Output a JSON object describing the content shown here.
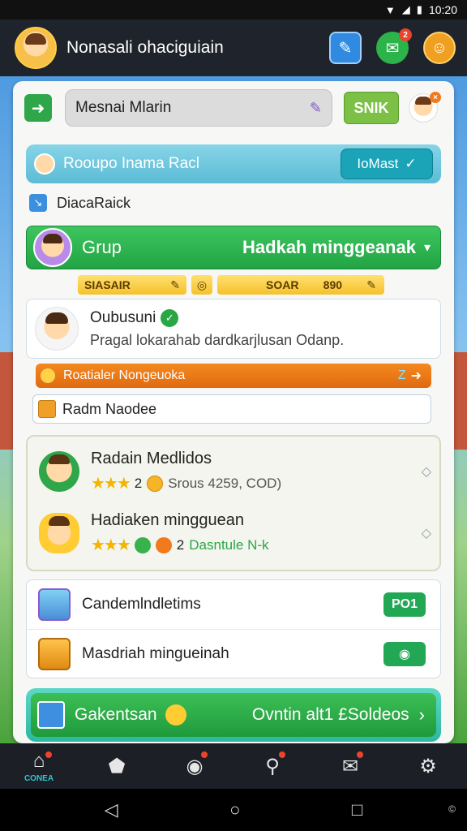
{
  "status_bar": {
    "time": "10:20",
    "wifi_icon": "wifi-icon",
    "signal_icon": "signal-icon",
    "battery_icon": "battery-icon"
  },
  "app_bar": {
    "title": "Nonasali ohaciguiain",
    "buttons": [
      {
        "icon": "edit-icon"
      },
      {
        "icon": "chat-icon",
        "badge": "2"
      },
      {
        "icon": "profile-icon"
      }
    ]
  },
  "search": {
    "value": "Mesnai Mlarin",
    "button": "SNIK"
  },
  "teal_banner": {
    "label": "Rooupo Inama Racl",
    "button": "IoMast"
  },
  "small_row": {
    "label": "DiacaRaick"
  },
  "group_header": {
    "left": "Grup",
    "right": "Hadkah minggeanak"
  },
  "yellow_bar": {
    "left": "SIASAIR",
    "middle": "SOAR",
    "value": "890"
  },
  "profile": {
    "name": "Oubusuni",
    "description": "Pragal lokarahab dardkarjlusan Odanp."
  },
  "orange_bar": {
    "label": "Roatialer Nongeuoka",
    "tag": "Z"
  },
  "input_row": {
    "value": "Radm Naodee"
  },
  "rewards": [
    {
      "title": "Radain Medlidos",
      "stars": "★★★",
      "count": "2",
      "extra": "Srous 4259, COD)"
    },
    {
      "title": "Hadiaken mingguean",
      "stars": "★★★",
      "count": "2",
      "extra": "Dasntule N-k"
    }
  ],
  "list": [
    {
      "label": "Candemlndletims",
      "button": "PO1"
    },
    {
      "label": "Masdriah mingueinah",
      "button": "◉"
    }
  ],
  "cta": {
    "left": "Gakentsan",
    "right": "Ovntin alt1 £Soldeos"
  },
  "bottom_nav": [
    {
      "icon": "home-icon",
      "label": "CONEA"
    },
    {
      "icon": "bookmark-icon",
      "label": ""
    },
    {
      "icon": "disc-icon",
      "label": ""
    },
    {
      "icon": "tools-icon",
      "label": ""
    },
    {
      "icon": "mail-icon",
      "label": ""
    },
    {
      "icon": "settings-icon",
      "label": ""
    }
  ],
  "colors": {
    "accent_green": "#22a444",
    "accent_teal": "#1ba3b8",
    "accent_orange": "#e06a10",
    "appbar": "#1f232b"
  }
}
